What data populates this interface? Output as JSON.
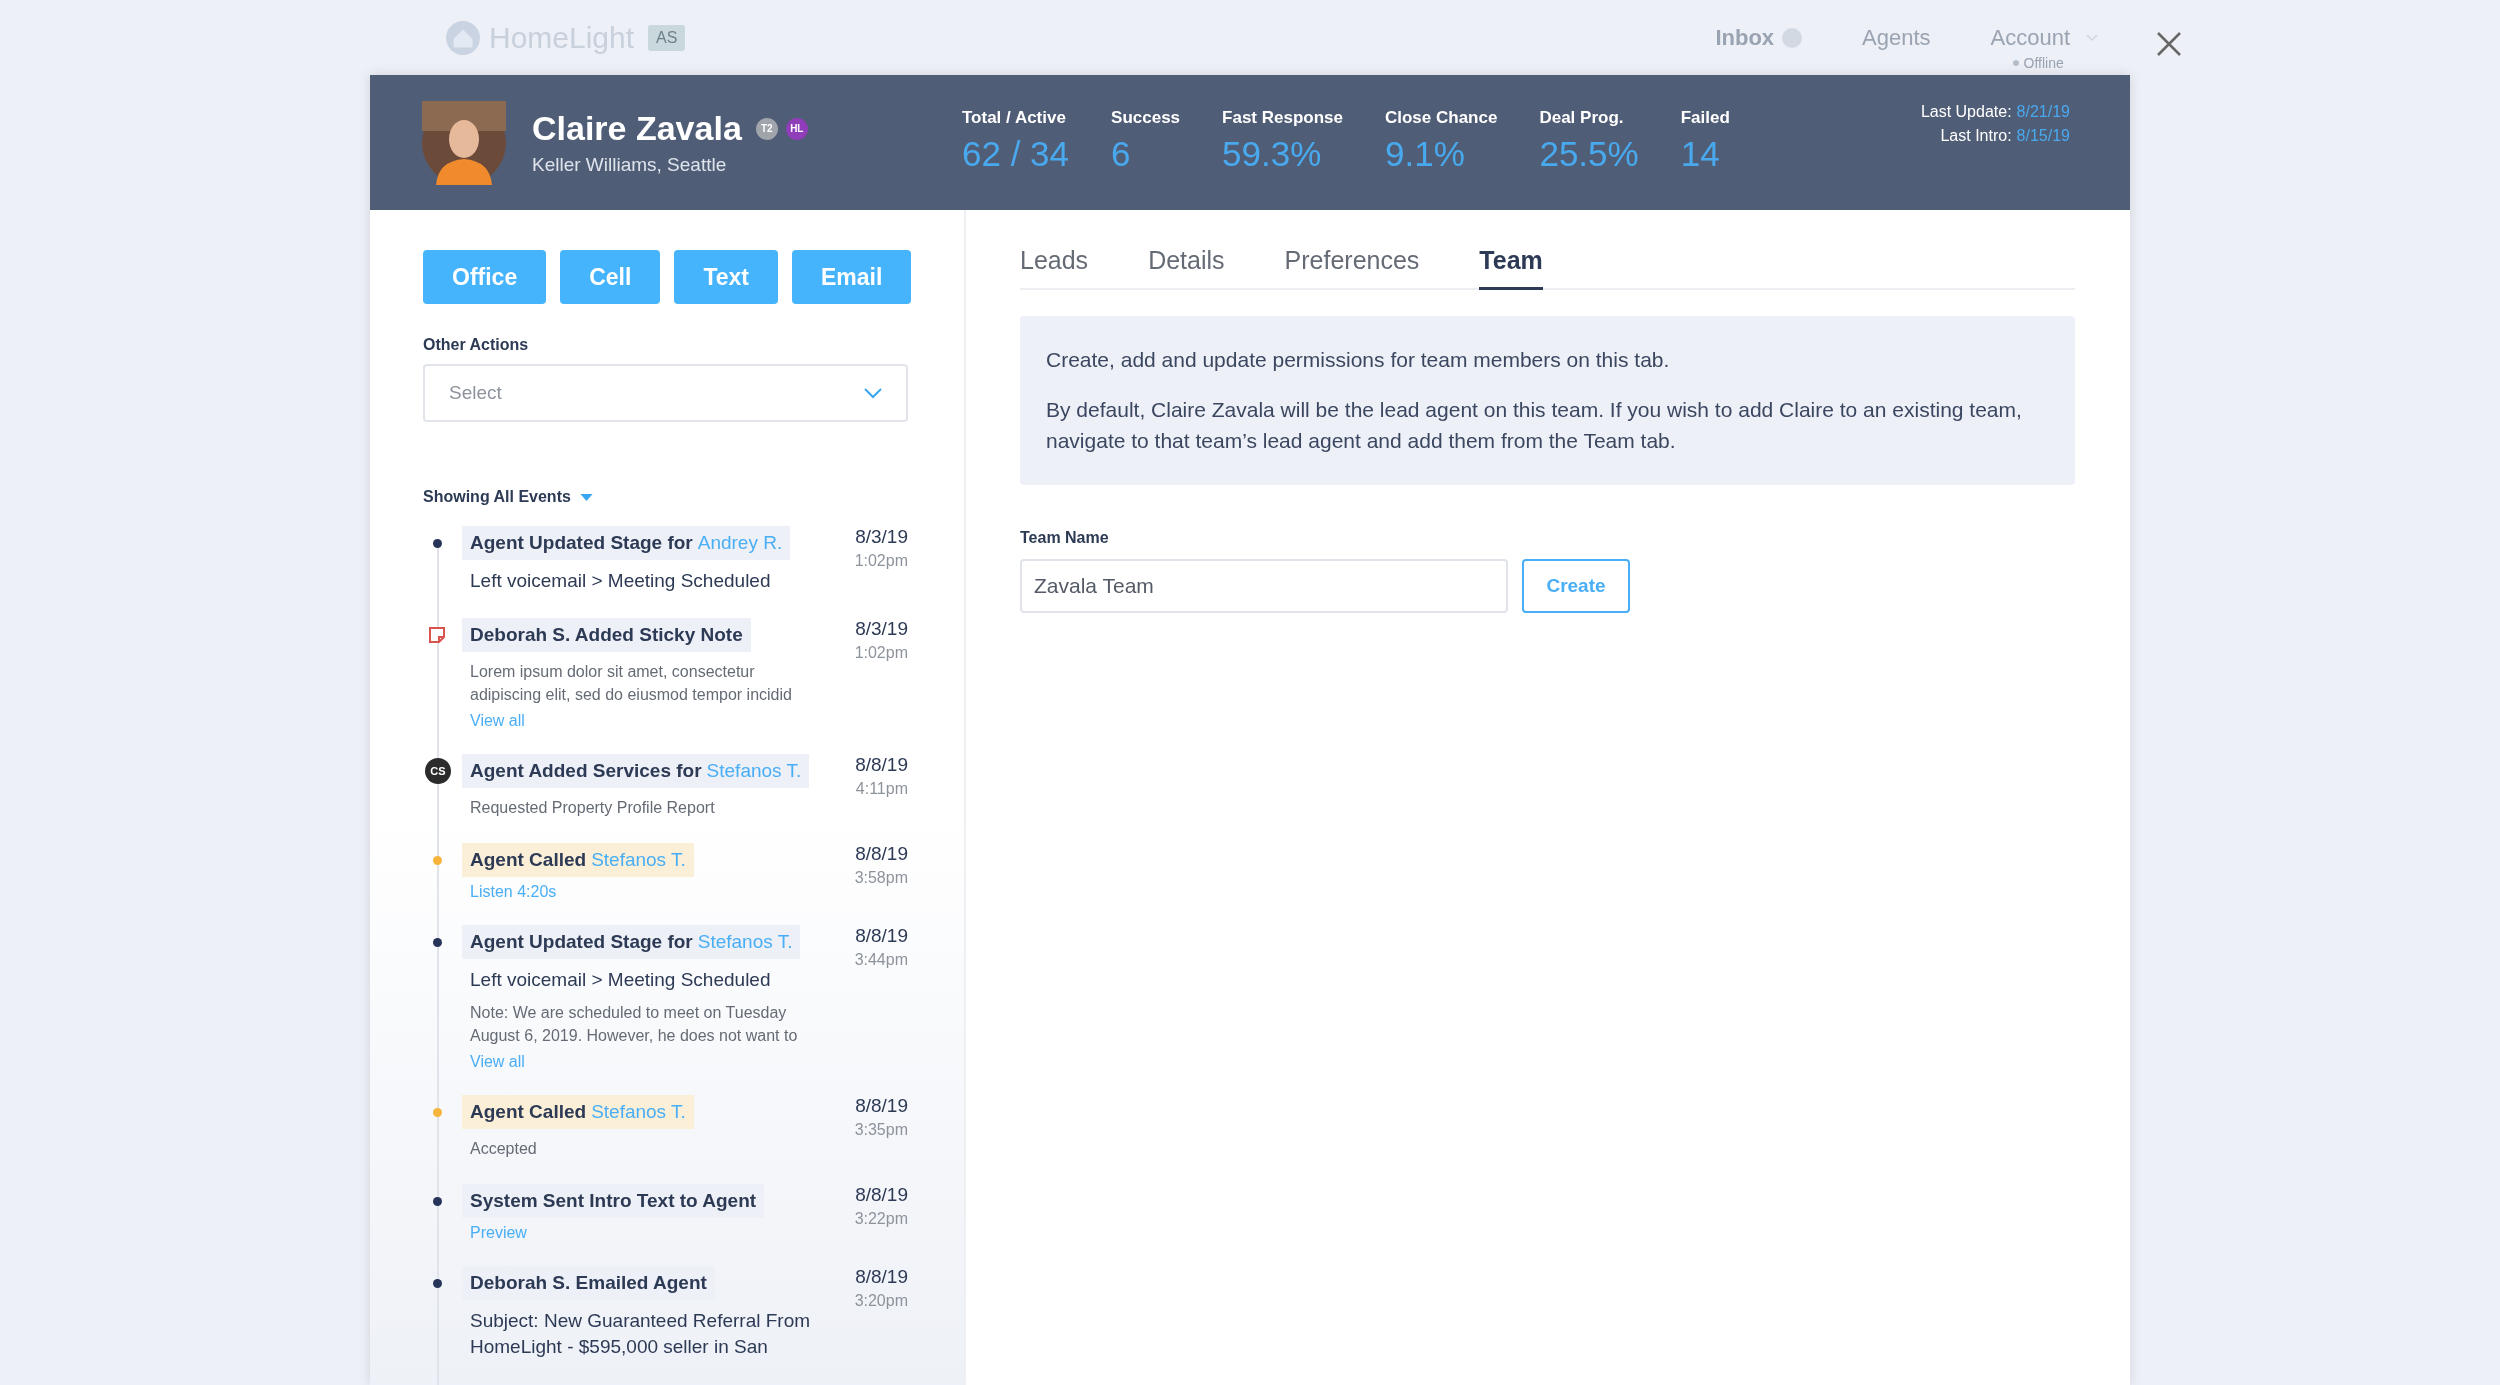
{
  "nav": {
    "logo": "HomeLight",
    "logo_badge": "AS",
    "items": [
      {
        "label": "Inbox",
        "kind": "badge"
      },
      {
        "label": "Agents",
        "kind": "plain"
      },
      {
        "label": "Account",
        "kind": "menu"
      }
    ],
    "status": "Offline"
  },
  "agent": {
    "name": "Claire Zavala",
    "company": "Keller Williams, Seattle",
    "badges": [
      {
        "label": "T2",
        "color": "#a0a4ab"
      },
      {
        "label": "HL",
        "color": "#8f3db8"
      }
    ]
  },
  "stats": [
    {
      "label": "Total / Active",
      "value": "62 / 34"
    },
    {
      "label": "Success",
      "value": "6"
    },
    {
      "label": "Fast Response",
      "value": "59.3%"
    },
    {
      "label": "Close Chance",
      "value": "9.1%"
    },
    {
      "label": "Deal Prog.",
      "value": "25.5%"
    },
    {
      "label": "Failed",
      "value": "14"
    }
  ],
  "dates": [
    {
      "label": "Last Update:",
      "value": "8/21/19"
    },
    {
      "label": "Last Intro:",
      "value": "8/15/19"
    }
  ],
  "contact_buttons": [
    "Office",
    "Cell",
    "Text",
    "Email"
  ],
  "other_actions": {
    "label": "Other Actions",
    "placeholder": "Select"
  },
  "events_filter": "Showing All Events",
  "events": [
    {
      "kind": "dot",
      "title": "Agent Updated Stage for",
      "link": "Andrey R.",
      "date": "8/3/19",
      "time": "1:02pm",
      "lines": [
        {
          "kind": "detail",
          "text": "Left voicemail > Meeting Scheduled"
        }
      ]
    },
    {
      "kind": "note",
      "title": "Deborah S. Added Sticky Note",
      "date": "8/3/19",
      "time": "1:02pm",
      "lines": [
        {
          "kind": "note",
          "text": "Lorem ipsum dolor sit amet, consectetur adipiscing elit, sed do eiusmod tempor incidid"
        },
        {
          "kind": "link",
          "text": "View all"
        }
      ]
    },
    {
      "kind": "initials",
      "marker_text": "CS",
      "title": "Agent Added Services for",
      "link": "Stefanos T.",
      "date": "8/8/19",
      "time": "4:11pm",
      "lines": [
        {
          "kind": "note",
          "text": "Requested Property Profile Report"
        }
      ]
    },
    {
      "kind": "call",
      "title": "Agent Called",
      "link": "Stefanos T.",
      "date": "8/8/19",
      "time": "3:58pm",
      "lines": [
        {
          "kind": "link",
          "text": "Listen 4:20s"
        }
      ]
    },
    {
      "kind": "dot",
      "title": "Agent Updated Stage for",
      "link": "Stefanos T.",
      "date": "8/8/19",
      "time": "3:44pm",
      "lines": [
        {
          "kind": "detail",
          "text": "Left voicemail > Meeting Scheduled"
        },
        {
          "kind": "note",
          "text": "Note: We are scheduled to meet on Tuesday August 6, 2019. However, he does not want to"
        },
        {
          "kind": "link",
          "text": "View all"
        }
      ]
    },
    {
      "kind": "call",
      "title": "Agent Called",
      "link": "Stefanos T.",
      "date": "8/8/19",
      "time": "3:35pm",
      "lines": [
        {
          "kind": "note",
          "text": "Accepted"
        }
      ]
    },
    {
      "kind": "dot",
      "title": "System Sent Intro Text to Agent",
      "date": "8/8/19",
      "time": "3:22pm",
      "lines": [
        {
          "kind": "link",
          "text": "Preview"
        }
      ]
    },
    {
      "kind": "dot",
      "title": "Deborah S. Emailed Agent",
      "date": "8/8/19",
      "time": "3:20pm",
      "lines": [
        {
          "kind": "detail",
          "text": "Subject: New Guaranteed Referral From HomeLight - $595,000 seller in San"
        }
      ]
    }
  ],
  "tabs": [
    {
      "label": "Leads",
      "selected": false
    },
    {
      "label": "Details",
      "selected": false
    },
    {
      "label": "Preferences",
      "selected": false
    },
    {
      "label": "Team",
      "selected": true
    }
  ],
  "info": [
    "Create, add and update permissions for team members on this tab.",
    "By default, Claire Zavala will be the lead agent on this team. If you wish to add Claire to an existing team, navigate to that team’s lead agent and add them from the Team tab."
  ],
  "team_name": {
    "label": "Team Name",
    "value": "Zavala Team"
  },
  "create_button": "Create"
}
